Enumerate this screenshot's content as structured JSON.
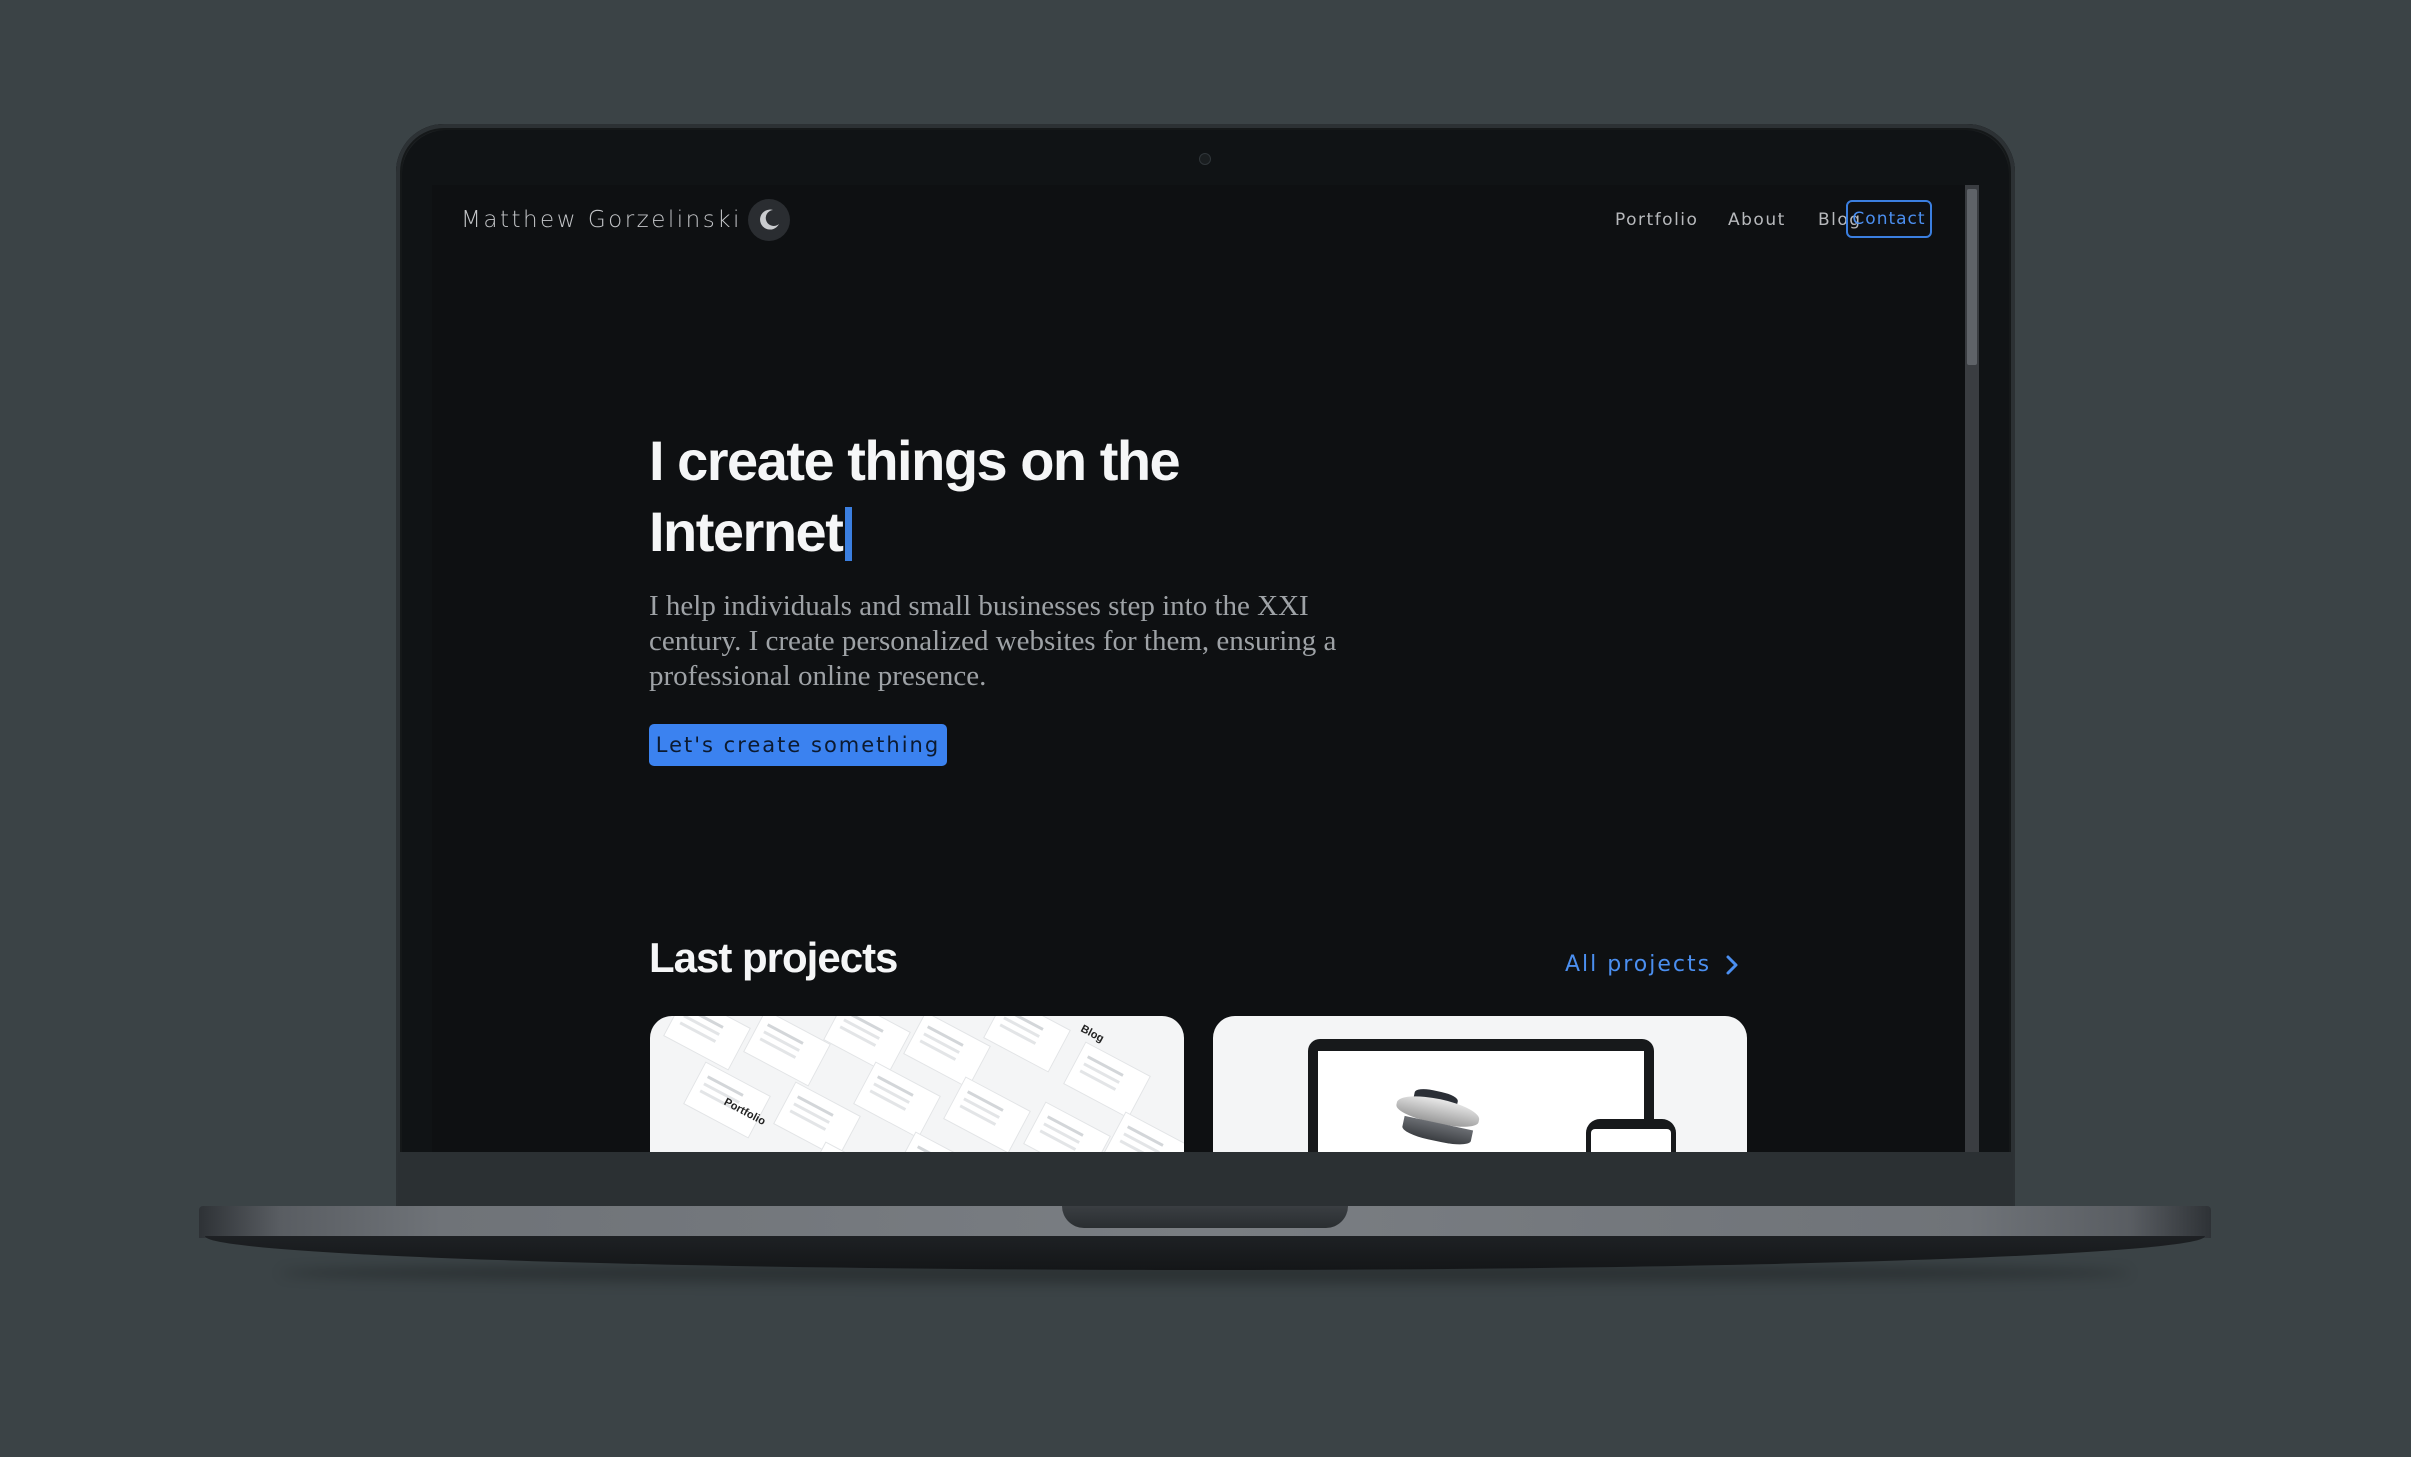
{
  "site": {
    "brand": "Matthew Gorzelinski",
    "theme_toggle_icon": "moon-icon"
  },
  "nav": {
    "items": [
      {
        "label": "Portfolio"
      },
      {
        "label": "About"
      },
      {
        "label": "Blog"
      }
    ],
    "contact_label": "Contact"
  },
  "hero": {
    "title_line1": "I create things on the",
    "title_line2": "Internet",
    "text": "I help individuals and small businesses step into the XXI century. I create personalized websites for them, ensuring a professional online presence.",
    "cta_label": "Let's create something"
  },
  "projects": {
    "title": "Last projects",
    "all_link": "All projects",
    "all_link_icon": "chevron-right-icon",
    "cards": [
      {
        "thumb_label_a": "Blog",
        "thumb_label_b": "Portfolio"
      },
      {}
    ]
  },
  "colors": {
    "accent": "#3b82f0",
    "background": "#0e1012",
    "page_backdrop": "#3b4346"
  }
}
